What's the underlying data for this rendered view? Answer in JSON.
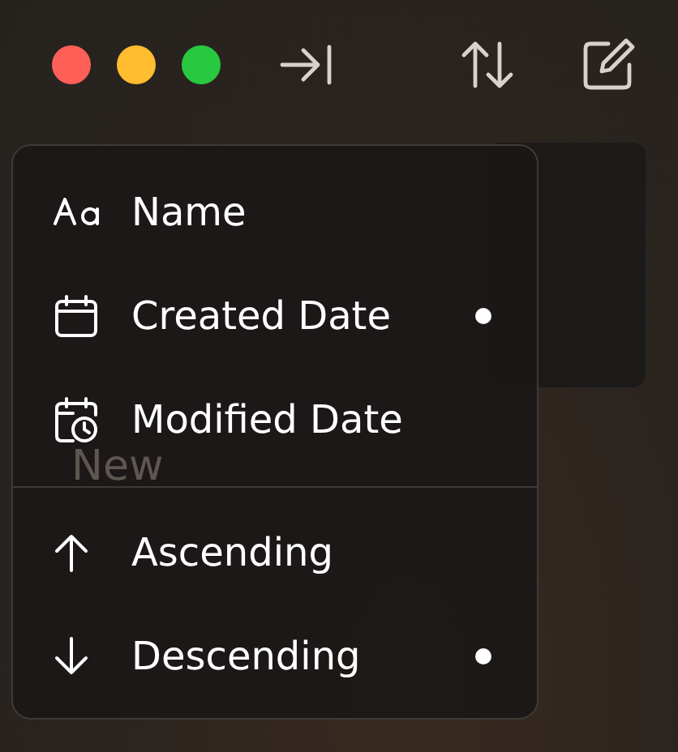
{
  "note": {
    "title": "New"
  },
  "menu": {
    "sections": [
      {
        "items": [
          {
            "kind": "letters",
            "label": "Name",
            "selected": false
          },
          {
            "kind": "calendar",
            "label": "Created Date",
            "selected": true
          },
          {
            "kind": "calendar-clock",
            "label": "Modified Date",
            "selected": false
          }
        ]
      },
      {
        "items": [
          {
            "kind": "arrow-up",
            "label": "Ascending",
            "selected": false
          },
          {
            "kind": "arrow-down",
            "label": "Descending",
            "selected": true
          }
        ]
      }
    ]
  }
}
